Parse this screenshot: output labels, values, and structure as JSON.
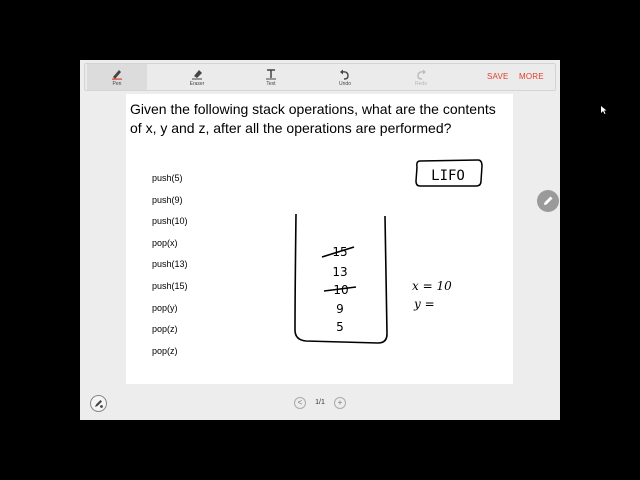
{
  "toolbar": {
    "tools": [
      {
        "label": "Pen",
        "icon": "pen-icon"
      },
      {
        "label": "Eraser",
        "icon": "eraser-icon"
      },
      {
        "label": "Text",
        "icon": "text-icon"
      },
      {
        "label": "Undo",
        "icon": "undo-icon"
      },
      {
        "label": "Redo",
        "icon": "redo-icon"
      }
    ],
    "save_label": "SAVE",
    "more_label": "MORE"
  },
  "question": "Given the following stack operations, what are the contents of x, y and z, after all the operations are performed?",
  "operations": [
    "push(5)",
    "push(9)",
    "push(10)",
    "pop(x)",
    "push(13)",
    "push(15)",
    "pop(y)",
    "pop(z)",
    "pop(z)"
  ],
  "handwriting": {
    "lifo": "LIFO",
    "stack_values": [
      "15",
      "13",
      "10",
      "9",
      "5"
    ],
    "x_note": "x = 10",
    "y_note": "y ="
  },
  "pager": {
    "indicator": "1/1",
    "prev": "<",
    "next": "+"
  },
  "colors": {
    "accent": "#e0402b",
    "background": "#ededed"
  }
}
